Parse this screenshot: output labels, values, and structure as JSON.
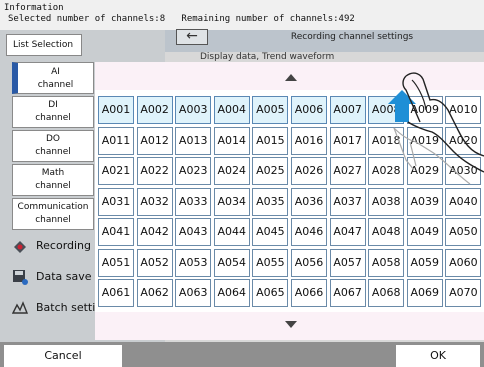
{
  "info": {
    "title": "Information",
    "selected": "Selected number of channels:8",
    "remaining": "Remaining number of channels:492"
  },
  "list_selection": "List Selection",
  "channel_types": [
    {
      "line1": "AI",
      "line2": "channel"
    },
    {
      "line1": "DI",
      "line2": "channel"
    },
    {
      "line1": "DO",
      "line2": "channel"
    },
    {
      "line1": "Math",
      "line2": "channel"
    },
    {
      "line1": "Communication",
      "line2": "channel"
    }
  ],
  "background_menu": [
    {
      "label": "Recording",
      "icon": "recording-icon"
    },
    {
      "label": "Data save",
      "icon": "data-save-icon"
    },
    {
      "label": "Batch setti",
      "icon": "batch-icon"
    }
  ],
  "header": {
    "title": "Recording channel settings",
    "back_icon": "back-arrow-icon",
    "display_text": "Display data, Trend waveform"
  },
  "channels": [
    [
      "A001",
      "A002",
      "A003",
      "A004",
      "A005",
      "A006",
      "A007",
      "A008",
      "A009",
      "A010"
    ],
    [
      "A011",
      "A012",
      "A013",
      "A014",
      "A015",
      "A016",
      "A017",
      "A018",
      "A019",
      "A020"
    ],
    [
      "A021",
      "A022",
      "A023",
      "A024",
      "A025",
      "A026",
      "A027",
      "A028",
      "A029",
      "A030"
    ],
    [
      "A031",
      "A032",
      "A033",
      "A034",
      "A035",
      "A036",
      "A037",
      "A038",
      "A039",
      "A040"
    ],
    [
      "A041",
      "A042",
      "A043",
      "A044",
      "A045",
      "A046",
      "A047",
      "A048",
      "A049",
      "A050"
    ],
    [
      "A051",
      "A052",
      "A053",
      "A054",
      "A055",
      "A056",
      "A057",
      "A058",
      "A059",
      "A060"
    ],
    [
      "A061",
      "A062",
      "A063",
      "A064",
      "A065",
      "A066",
      "A067",
      "A068",
      "A069",
      "A070"
    ]
  ],
  "selected_channels": [
    "A001",
    "A002",
    "A003",
    "A004",
    "A005",
    "A006",
    "A007",
    "A008"
  ],
  "buttons": {
    "cancel": "Cancel",
    "ok": "OK"
  },
  "colors": {
    "selected_cell": "#dff3fb",
    "swipe_arrow": "#1f8fd6"
  }
}
